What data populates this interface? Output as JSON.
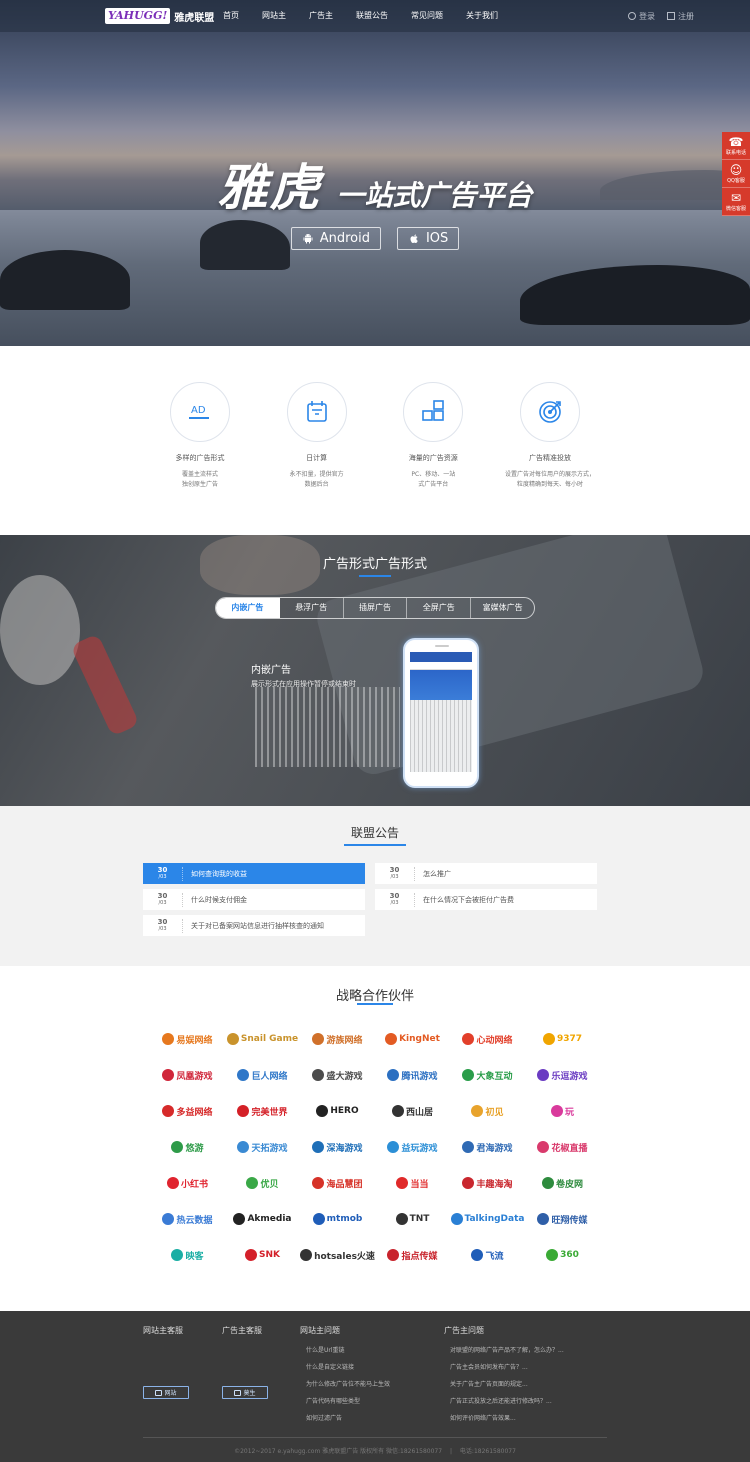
{
  "header": {
    "logo_mark": "YAHUGG!",
    "logo_name": "雅虎联盟",
    "nav": [
      "首页",
      "网站主",
      "广告主",
      "联盟公告",
      "常见问题",
      "关于我们"
    ],
    "login": "登录",
    "register": "注册"
  },
  "hero": {
    "title_big": "雅虎",
    "title_sub": "一站式广告平台",
    "android_label": "Android",
    "ios_label": "IOS"
  },
  "side_float": [
    "联系电话",
    "QQ客服",
    "微信客服"
  ],
  "features": [
    {
      "title": "多样的广告形式",
      "desc1": "覆盖主流样式",
      "desc2": "独创原生广告",
      "icon": "ad-icon"
    },
    {
      "title": "日计算",
      "desc1": "永不扣量，提供官方",
      "desc2": "数据后台",
      "icon": "calendar-icon"
    },
    {
      "title": "海量的广告资源",
      "desc1": "PC、移动、一站",
      "desc2": "式广告平台",
      "icon": "grid-icon"
    },
    {
      "title": "广告精准投放",
      "desc1": "设置广告对每位用户的展示方式，",
      "desc2": "粒度精确到每天、每小时",
      "icon": "target-icon"
    }
  ],
  "adforms": {
    "heading": "广告形式广告形式",
    "tabs": [
      "内嵌广告",
      "悬浮广告",
      "插屏广告",
      "全屏广告",
      "富媒体广告"
    ],
    "active_tab": 0,
    "form_title": "内嵌广告",
    "form_desc": "展示形式在应用操作暂停或结束时"
  },
  "notice": {
    "heading": "联盟公告",
    "left": [
      {
        "day": "30",
        "month": "/03",
        "text": "如何查询我的收益",
        "active": true
      },
      {
        "day": "30",
        "month": "/03",
        "text": "什么时候支付佣金",
        "active": false
      },
      {
        "day": "30",
        "month": "/03",
        "text": "关于对已备案网站信息进行抽样核查的通知",
        "active": false
      }
    ],
    "right": [
      {
        "day": "30",
        "month": "/03",
        "text": "怎么推广",
        "active": false
      },
      {
        "day": "30",
        "month": "/03",
        "text": "在什么情况下会被拒付广告费",
        "active": false
      }
    ]
  },
  "partners": {
    "heading": "战略合作伙伴",
    "logos": [
      {
        "name": "易娱网络",
        "color": "#e6781e"
      },
      {
        "name": "Snail Game",
        "color": "#c9932c"
      },
      {
        "name": "游族网络",
        "color": "#d0702a"
      },
      {
        "name": "KingNet",
        "color": "#e35b23"
      },
      {
        "name": "心动网络",
        "color": "#e23f2a"
      },
      {
        "name": "9377",
        "color": "#f0a500"
      },
      {
        "name": "凤凰游戏",
        "color": "#d0263a"
      },
      {
        "name": "巨人网络",
        "color": "#2f77c8"
      },
      {
        "name": "盛大游戏",
        "color": "#4c4c4c"
      },
      {
        "name": "腾讯游戏",
        "color": "#2b6fc1"
      },
      {
        "name": "大象互动",
        "color": "#2a9d4a"
      },
      {
        "name": "乐逗游戏",
        "color": "#6a3bc2"
      },
      {
        "name": "多益网络",
        "color": "#d62a2a"
      },
      {
        "name": "完美世界",
        "color": "#d42027"
      },
      {
        "name": "HERO",
        "color": "#222222"
      },
      {
        "name": "西山居",
        "color": "#333333"
      },
      {
        "name": "初见",
        "color": "#e8a32c"
      },
      {
        "name": "玩",
        "color": "#d93a9c"
      },
      {
        "name": "悠游",
        "color": "#2e9b49"
      },
      {
        "name": "天拓游戏",
        "color": "#3a8ad3"
      },
      {
        "name": "深海游戏",
        "color": "#1f6fb8"
      },
      {
        "name": "益玩游戏",
        "color": "#2c8fd6"
      },
      {
        "name": "君海游戏",
        "color": "#2f6ab4"
      },
      {
        "name": "花椒直播",
        "color": "#d93a6c"
      },
      {
        "name": "小红书",
        "color": "#e0242f"
      },
      {
        "name": "优贝",
        "color": "#3aa847"
      },
      {
        "name": "海品慧团",
        "color": "#d63228"
      },
      {
        "name": "当当",
        "color": "#e02a2a"
      },
      {
        "name": "丰趣海淘",
        "color": "#c9272e"
      },
      {
        "name": "卷皮网",
        "color": "#2e8b3e"
      },
      {
        "name": "热云数据",
        "color": "#3a7bd5"
      },
      {
        "name": "Akmedia",
        "color": "#222222"
      },
      {
        "name": "mtmob",
        "color": "#1f5db8"
      },
      {
        "name": "TNT",
        "color": "#333333"
      },
      {
        "name": "TalkingData",
        "color": "#2a7fd4"
      },
      {
        "name": "旺翔传媒",
        "color": "#2f5fa8"
      },
      {
        "name": "映客",
        "color": "#1aaea4"
      },
      {
        "name": "SNK",
        "color": "#d4202a"
      },
      {
        "name": "hotsales火速",
        "color": "#333333"
      },
      {
        "name": "指点传媒",
        "color": "#c8232c"
      },
      {
        "name": "飞流",
        "color": "#1f5db8"
      },
      {
        "name": "360",
        "color": "#3aaa35"
      }
    ]
  },
  "footer": {
    "col1": "网站主客服",
    "col2": "广告主客服",
    "col3": "网站主问题",
    "col4": "广告主问题",
    "btn1": "网站",
    "btn2": "莫生",
    "site_links": [
      "什么是Url重链",
      "什么是自定义链接",
      "为什么修改广告位不能马上生效",
      "广告代码有哪些类型",
      "如何过滤广告"
    ],
    "adv_links": [
      "对联盟的网络广告产品不了解，怎么办？...",
      "广告主会员如何发布广告？...",
      "关于广告主广告页面的规定...",
      "广告正式投放之后还能进行修改吗？...",
      "如何评价网络广告效果..."
    ],
    "copyright": "©2012~2017 e.yahugg.com 雅虎联盟广告 版权所有 微信:18261580077",
    "phone": "电话:18261580077"
  },
  "colors": {
    "accent": "#2b86e8",
    "side_float": "#d63a2b",
    "footer": "#3a3a3a"
  }
}
